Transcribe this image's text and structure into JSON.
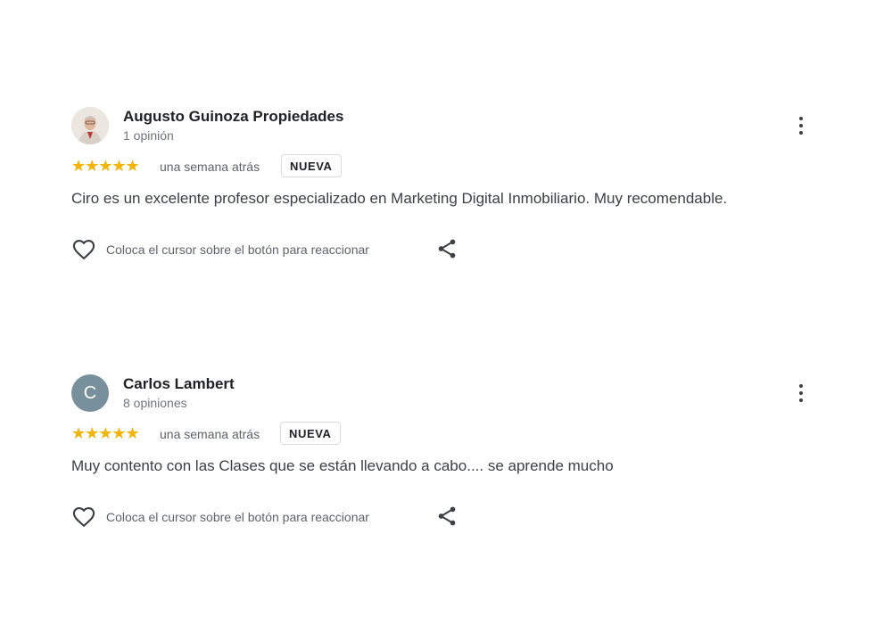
{
  "reviews": [
    {
      "name": "Augusto Guinoza Propiedades",
      "review_count": "1 opinión",
      "avatar_type": "photo",
      "avatar_letter": "",
      "rating": 5,
      "stars": "★★★★★",
      "time_ago": "una semana atrás",
      "badge": "NUEVA",
      "text": "Ciro es un excelente profesor especializado en Marketing Digital Inmobiliario. Muy recomendable.",
      "react_hint": "Coloca el cursor sobre el botón para reaccionar"
    },
    {
      "name": "Carlos Lambert",
      "review_count": "8 opiniones",
      "avatar_type": "letter",
      "avatar_letter": "C",
      "rating": 5,
      "stars": "★★★★★",
      "time_ago": "una semana atrás",
      "badge": "NUEVA",
      "text": "Muy contento con las Clases que se están llevando a cabo.... se aprende mucho",
      "react_hint": "Coloca el cursor sobre el botón para reaccionar"
    }
  ],
  "icons": {
    "menu": "more-vert-icon",
    "react": "heart-outline-icon",
    "share": "share-icon"
  },
  "colors": {
    "star": "#f4b400",
    "letter_avatar": "#78909c",
    "name": "#202124",
    "secondary": "#5f6368",
    "body": "#3c4043"
  }
}
